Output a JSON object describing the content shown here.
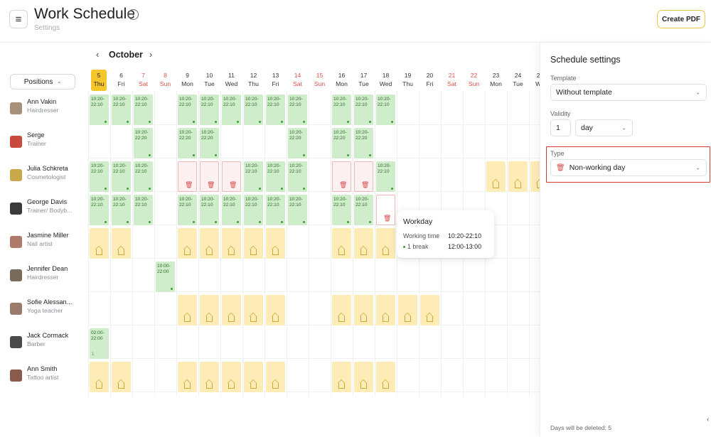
{
  "header": {
    "menu_icon": "hamburger-icon",
    "title": "Work Schedule",
    "info_icon": "info-icon",
    "breadcrumb": "Settings",
    "create_pdf": "Create PDF"
  },
  "toolbar": {
    "positions_label": "Positions",
    "month": "October",
    "prev_icon": "chevron-left-icon",
    "next_icon": "chevron-right-icon"
  },
  "days": [
    {
      "num": "5",
      "wd": "Thu",
      "type": "today"
    },
    {
      "num": "6",
      "wd": "Fri",
      "type": "normal"
    },
    {
      "num": "7",
      "wd": "Sat",
      "type": "weekend"
    },
    {
      "num": "8",
      "wd": "Sun",
      "type": "weekend"
    },
    {
      "num": "9",
      "wd": "Mon",
      "type": "normal"
    },
    {
      "num": "10",
      "wd": "Tue",
      "type": "normal"
    },
    {
      "num": "11",
      "wd": "Wed",
      "type": "normal"
    },
    {
      "num": "12",
      "wd": "Thu",
      "type": "normal"
    },
    {
      "num": "13",
      "wd": "Fri",
      "type": "normal"
    },
    {
      "num": "14",
      "wd": "Sat",
      "type": "weekend"
    },
    {
      "num": "15",
      "wd": "Sun",
      "type": "weekend"
    },
    {
      "num": "16",
      "wd": "Mon",
      "type": "normal"
    },
    {
      "num": "17",
      "wd": "Tue",
      "type": "normal"
    },
    {
      "num": "18",
      "wd": "Wed",
      "type": "normal"
    },
    {
      "num": "19",
      "wd": "Thu",
      "type": "normal"
    },
    {
      "num": "20",
      "wd": "Fri",
      "type": "normal"
    },
    {
      "num": "21",
      "wd": "Sat",
      "type": "weekend"
    },
    {
      "num": "22",
      "wd": "Sun",
      "type": "weekend"
    },
    {
      "num": "23",
      "wd": "Mon",
      "type": "normal"
    },
    {
      "num": "24",
      "wd": "Tue",
      "type": "normal"
    },
    {
      "num": "25",
      "wd": "We",
      "type": "normal"
    }
  ],
  "employees": [
    {
      "name": "Ann Vakin",
      "role": "Hairdresser",
      "avatar_color": "#a88f7a",
      "cells": [
        "W",
        "W",
        "W",
        "",
        "W",
        "W",
        "W",
        "W",
        "W",
        "W",
        "",
        "W",
        "W",
        "W",
        "",
        "",
        "",
        "",
        "",
        "",
        ""
      ]
    },
    {
      "name": "Serge",
      "role": "Trainer",
      "avatar_color": "#c94a3c",
      "cells": [
        "",
        "",
        "W2",
        "",
        "W2",
        "W2",
        "",
        "",
        "",
        "W2",
        "",
        "W2",
        "W2",
        "",
        "",
        "",
        "",
        "",
        "",
        "",
        ""
      ]
    },
    {
      "name": "Julia Schkreta",
      "role": "Cosmetologist",
      "avatar_color": "#c9a84a",
      "cells": [
        "W",
        "W",
        "W",
        "",
        "N",
        "N",
        "N",
        "W",
        "W",
        "W",
        "",
        "N",
        "N",
        "W",
        "",
        "",
        "",
        "",
        "O",
        "O",
        "O"
      ]
    },
    {
      "name": "George Davis",
      "role": "Trainer/ Bodyb...",
      "avatar_color": "#3a3a3a",
      "cells": [
        "W",
        "W",
        "W",
        "",
        "W",
        "W",
        "W",
        "W",
        "W",
        "W",
        "",
        "W",
        "W",
        "E",
        "",
        "",
        "",
        "",
        "",
        "",
        ""
      ]
    },
    {
      "name": "Jasmine Miller",
      "role": "Nail artist",
      "avatar_color": "#b07a6a",
      "cells": [
        "O",
        "O",
        "",
        "",
        "O",
        "O",
        "O",
        "O",
        "O",
        "",
        "",
        "O",
        "O",
        "O",
        "",
        "",
        "",
        "",
        "",
        "",
        ""
      ]
    },
    {
      "name": "Jennifer Dean",
      "role": "Hairdresser",
      "avatar_color": "#7a6a5a",
      "cells": [
        "",
        "",
        "",
        "W3",
        "",
        "",
        "",
        "",
        "",
        "",
        "",
        "",
        "",
        "",
        "",
        "",
        "",
        "",
        "",
        "",
        ""
      ]
    },
    {
      "name": "Sofie Alessan...",
      "role": "Yoga teacher",
      "avatar_color": "#9a7a6a",
      "cells": [
        "",
        "",
        "",
        "",
        "O",
        "O",
        "O",
        "O",
        "O",
        "",
        "",
        "O",
        "O",
        "O",
        "O",
        "O",
        "",
        "",
        "",
        "",
        ""
      ]
    },
    {
      "name": "Jack Cormack",
      "role": "Barber",
      "avatar_color": "#4a4a4a",
      "cells": [
        "W4",
        "",
        "",
        "",
        "",
        "",
        "",
        "",
        "",
        "",
        "",
        "",
        "",
        "",
        "",
        "",
        "",
        "",
        "",
        "",
        ""
      ]
    },
    {
      "name": "Ann Smith",
      "role": "Tattoo artist",
      "avatar_color": "#8a5a4a",
      "cells": [
        "O",
        "O",
        "",
        "",
        "O",
        "O",
        "O",
        "O",
        "O",
        "",
        "",
        "O",
        "O",
        "O",
        "",
        "",
        "",
        "",
        "",
        "",
        ""
      ]
    }
  ],
  "shift_labels": {
    "W": "10:20-\n22:10",
    "W2": "10:20-\n22:20",
    "W3": "10:00-\n22:00",
    "W4": "02:00-\n22:00"
  },
  "tooltip": {
    "title": "Workday",
    "time_label": "Working time",
    "time_value": "10:20-22:10",
    "break_label": "1 break",
    "break_value": "12:00-13:00"
  },
  "panel": {
    "title": "Schedule settings",
    "template_label": "Template",
    "template_value": "Without template",
    "validity_label": "Validity",
    "validity_count": "1",
    "validity_unit": "day",
    "type_label": "Type",
    "type_value": "Non-working day",
    "footer": "Days will be deleted: 5"
  },
  "colors": {
    "accent": "#f5c52c",
    "workday": "#cfeccb",
    "dayoff": "#fdecb6",
    "nonworking_border": "#f1b8b8",
    "highlight": "#d63b30"
  }
}
